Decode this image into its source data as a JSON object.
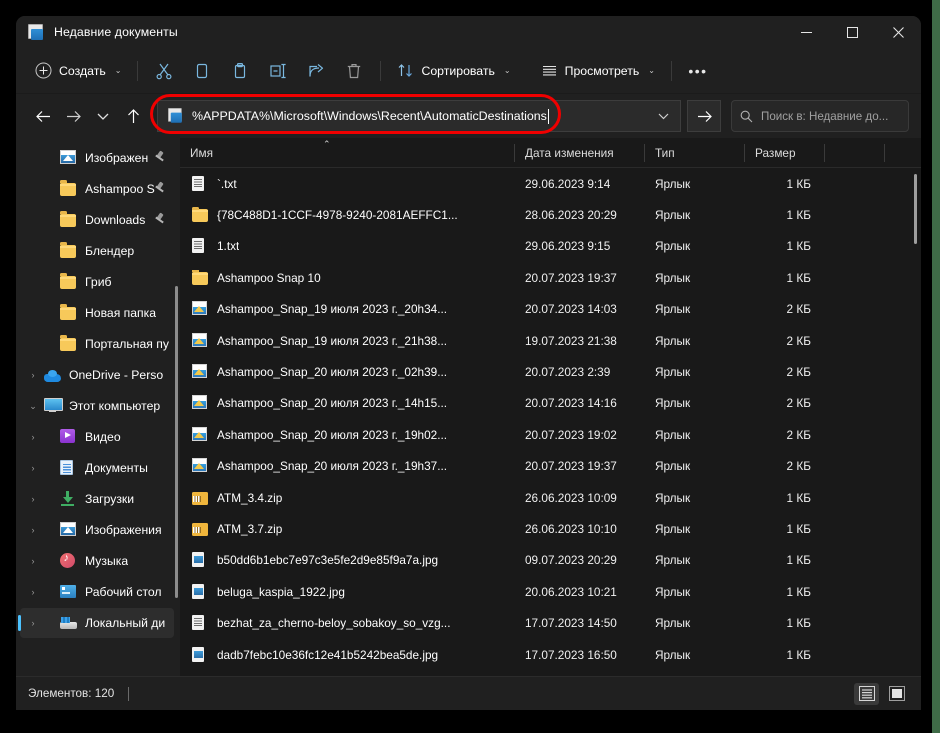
{
  "window": {
    "title": "Недавние документы",
    "title_icon": "recent-documents-icon",
    "controls": {
      "minimize": "—",
      "maximize": "□",
      "close": "✕"
    }
  },
  "command_bar": {
    "new_label": "Создать",
    "cut_label": "Вырезать",
    "copy_label": "Копировать",
    "paste_label": "Вставить",
    "rename_label": "Переименовать",
    "share_label": "Поделиться",
    "delete_label": "Удалить",
    "sort_label": "Сортировать",
    "view_label": "Просмотреть",
    "more_label": "•••",
    "chevron": "⌄"
  },
  "address_bar": {
    "back": "←",
    "forward": "→",
    "recent_chevron": "⌄",
    "up": "↑",
    "path_icon": "recent-documents-icon",
    "path_value": "%APPDATA%\\Microsoft\\Windows\\Recent\\AutomaticDestinations",
    "history_chevron": "⌄",
    "go": "→",
    "highlight_color": "#f00000"
  },
  "search": {
    "icon": "search-icon",
    "placeholder": "Поиск в: Недавние до..."
  },
  "nav_pane": {
    "items": [
      {
        "label": "Изображен",
        "icon": "pictures-icon",
        "indent": 1,
        "expander": "",
        "pinned": true,
        "selected": false
      },
      {
        "label": "Ashampoo S",
        "icon": "folder-icon",
        "indent": 1,
        "expander": "",
        "pinned": true,
        "selected": false
      },
      {
        "label": "Downloads",
        "icon": "folder-icon",
        "indent": 1,
        "expander": "",
        "pinned": true,
        "selected": false
      },
      {
        "label": "Блендер",
        "icon": "folder-icon",
        "indent": 1,
        "expander": "",
        "pinned": false,
        "selected": false
      },
      {
        "label": "Гриб",
        "icon": "folder-icon",
        "indent": 1,
        "expander": "",
        "pinned": false,
        "selected": false
      },
      {
        "label": "Новая папка",
        "icon": "folder-icon",
        "indent": 1,
        "expander": "",
        "pinned": false,
        "selected": false
      },
      {
        "label": "Портальная пу",
        "icon": "folder-icon",
        "indent": 1,
        "expander": "",
        "pinned": false,
        "selected": false
      },
      {
        "label": "OneDrive - Perso",
        "icon": "onedrive-icon",
        "indent": 0,
        "expander": "›",
        "pinned": false,
        "selected": false
      },
      {
        "label": "Этот компьютер",
        "icon": "this-pc-icon",
        "indent": 0,
        "expander": "⌄",
        "pinned": false,
        "selected": false
      },
      {
        "label": "Видео",
        "icon": "videos-icon",
        "indent": 1,
        "expander": "›",
        "pinned": false,
        "selected": false
      },
      {
        "label": "Документы",
        "icon": "documents-icon",
        "indent": 1,
        "expander": "›",
        "pinned": false,
        "selected": false
      },
      {
        "label": "Загрузки",
        "icon": "downloads-icon",
        "indent": 1,
        "expander": "›",
        "pinned": false,
        "selected": false
      },
      {
        "label": "Изображения",
        "icon": "pictures-icon",
        "indent": 1,
        "expander": "›",
        "pinned": false,
        "selected": false
      },
      {
        "label": "Музыка",
        "icon": "music-icon",
        "indent": 1,
        "expander": "›",
        "pinned": false,
        "selected": false
      },
      {
        "label": "Рабочий стол",
        "icon": "desktop-icon",
        "indent": 1,
        "expander": "›",
        "pinned": false,
        "selected": false
      },
      {
        "label": "Локальный ди",
        "icon": "local-disk-icon",
        "indent": 1,
        "expander": "›",
        "pinned": false,
        "selected": true
      }
    ]
  },
  "file_list": {
    "columns": [
      {
        "key": "name",
        "label": "Имя",
        "sorted": true,
        "sort_caret": "⌃"
      },
      {
        "key": "date",
        "label": "Дата изменения",
        "sorted": false,
        "sort_caret": ""
      },
      {
        "key": "type",
        "label": "Тип",
        "sorted": false,
        "sort_caret": ""
      },
      {
        "key": "size",
        "label": "Размер",
        "sorted": false,
        "sort_caret": ""
      }
    ],
    "rows": [
      {
        "name": "`.txt",
        "date": "29.06.2023 9:14",
        "type": "Ярлык",
        "size": "1 КБ",
        "icon": "txt-file-icon"
      },
      {
        "name": "{78C488D1-1CCF-4978-9240-2081AEFFC1...",
        "date": "28.06.2023 20:29",
        "type": "Ярлык",
        "size": "1 КБ",
        "icon": "folder-icon"
      },
      {
        "name": "1.txt",
        "date": "29.06.2023 9:15",
        "type": "Ярлык",
        "size": "1 КБ",
        "icon": "txt-file-icon"
      },
      {
        "name": "Ashampoo Snap 10",
        "date": "20.07.2023 19:37",
        "type": "Ярлык",
        "size": "1 КБ",
        "icon": "folder-icon"
      },
      {
        "name": "Ashampoo_Snap_19 июля 2023 г._20h34...",
        "date": "20.07.2023 14:03",
        "type": "Ярлык",
        "size": "2 КБ",
        "icon": "image-file-icon"
      },
      {
        "name": "Ashampoo_Snap_19 июля 2023 г._21h38...",
        "date": "19.07.2023 21:38",
        "type": "Ярлык",
        "size": "2 КБ",
        "icon": "image-file-icon"
      },
      {
        "name": "Ashampoo_Snap_20 июля 2023 г._02h39...",
        "date": "20.07.2023 2:39",
        "type": "Ярлык",
        "size": "2 КБ",
        "icon": "image-file-icon"
      },
      {
        "name": "Ashampoo_Snap_20 июля 2023 г._14h15...",
        "date": "20.07.2023 14:16",
        "type": "Ярлык",
        "size": "2 КБ",
        "icon": "image-file-icon"
      },
      {
        "name": "Ashampoo_Snap_20 июля 2023 г._19h02...",
        "date": "20.07.2023 19:02",
        "type": "Ярлык",
        "size": "2 КБ",
        "icon": "image-file-icon"
      },
      {
        "name": "Ashampoo_Snap_20 июля 2023 г._19h37...",
        "date": "20.07.2023 19:37",
        "type": "Ярлык",
        "size": "2 КБ",
        "icon": "image-file-icon"
      },
      {
        "name": "ATM_3.4.zip",
        "date": "26.06.2023 10:09",
        "type": "Ярлык",
        "size": "1 КБ",
        "icon": "zip-file-icon"
      },
      {
        "name": "ATM_3.7.zip",
        "date": "26.06.2023 10:10",
        "type": "Ярлык",
        "size": "1 КБ",
        "icon": "zip-file-icon"
      },
      {
        "name": "b50dd6b1ebc7e97c3e5fe2d9e85f9a7a.jpg",
        "date": "09.07.2023 20:29",
        "type": "Ярлык",
        "size": "1 КБ",
        "icon": "jpg-file-icon"
      },
      {
        "name": "beluga_kaspia_1922.jpg",
        "date": "20.06.2023 10:21",
        "type": "Ярлык",
        "size": "1 КБ",
        "icon": "jpg-file-icon"
      },
      {
        "name": "bezhat_za_cherno-beloy_sobakoy_so_vzg...",
        "date": "17.07.2023 14:50",
        "type": "Ярлык",
        "size": "1 КБ",
        "icon": "txt-file-icon"
      },
      {
        "name": "dadb7febc10e36fc12e41b5242bea5de.jpg",
        "date": "17.07.2023 16:50",
        "type": "Ярлык",
        "size": "1 КБ",
        "icon": "jpg-file-icon"
      }
    ]
  },
  "status_bar": {
    "item_count_label": "Элементов: 120",
    "details_view": "details-view-icon",
    "large_icons_view": "large-icons-view-icon"
  }
}
